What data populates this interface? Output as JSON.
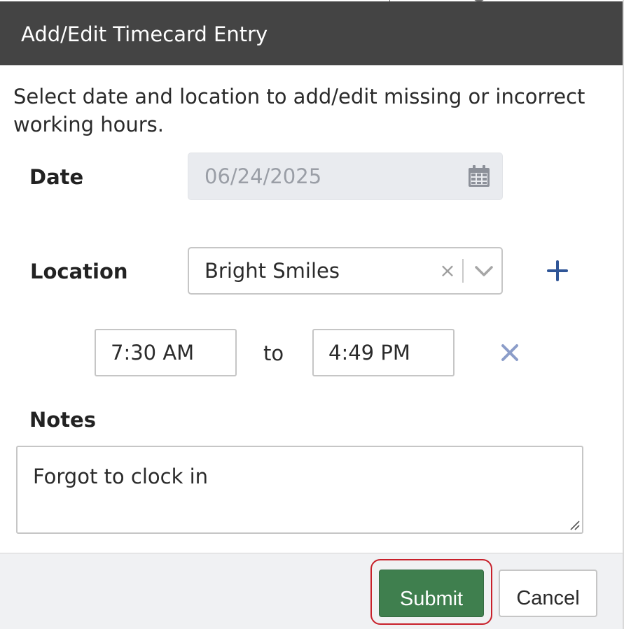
{
  "dialog": {
    "title": "Add/Edit Timecard Entry",
    "instructions": "Select date and location to add/edit missing or incorrect working hours."
  },
  "form": {
    "date_label": "Date",
    "date_value": "06/24/2025",
    "location_label": "Location",
    "location_value": "Bright Smiles",
    "time_start": "7:30 AM",
    "time_separator": "to",
    "time_end": "4:49 PM",
    "notes_label": "Notes",
    "notes_value": "Forgot to clock in"
  },
  "footer": {
    "submit_label": "Submit",
    "cancel_label": "Cancel"
  },
  "icons": {
    "date": "calendar-icon",
    "clear": "clear-icon",
    "dropdown": "chevron-down-icon",
    "add": "plus-icon",
    "remove": "close-icon",
    "resize": "resize-grip-icon"
  },
  "colors": {
    "title_bar": "#444444",
    "submit": "#3f7f4e",
    "accent_blue": "#2f5597",
    "highlight": "#c8202a"
  }
}
